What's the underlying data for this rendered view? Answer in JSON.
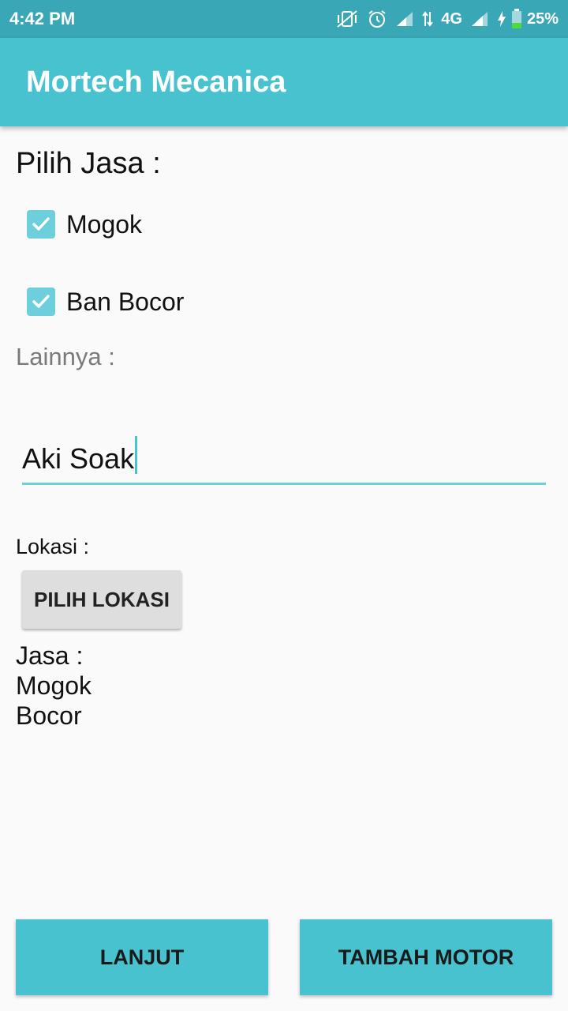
{
  "status_bar": {
    "time": "4:42 PM",
    "network": "4G",
    "battery": "25%",
    "icons": [
      "vibrate-off-icon",
      "alarm-icon",
      "signal-icon",
      "data-arrows-icon",
      "signal-icon",
      "charging-icon",
      "battery-icon"
    ]
  },
  "app_bar": {
    "title": "Mortech Mecanica"
  },
  "form": {
    "section_title": "Pilih Jasa :",
    "checkboxes": [
      {
        "label": "Mogok",
        "checked": true
      },
      {
        "label": "Ban Bocor",
        "checked": true
      }
    ],
    "other_label": "Lainnya :",
    "other_value": "Aki Soak",
    "location_label": "Lokasi :",
    "pick_location_button": "PILIH LOKASI"
  },
  "summary": {
    "heading": "Jasa :",
    "lines": [
      "Mogok",
      "Bocor"
    ]
  },
  "buttons": {
    "next": "LANJUT",
    "add_motor": "TAMBAH MOTOR"
  },
  "colors": {
    "status_bar": "#3aa7b6",
    "accent": "#48c2cf",
    "checkbox": "#6dcfdb",
    "background": "#fafafa"
  }
}
